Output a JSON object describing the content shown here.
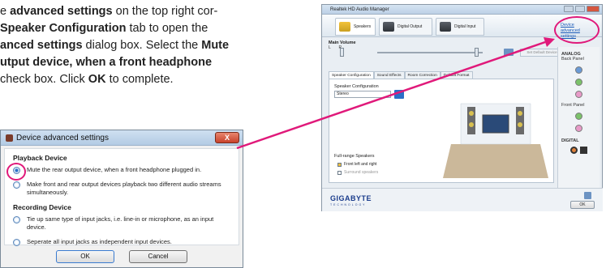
{
  "instructions": {
    "l1_pre": "e ",
    "l1_bold": "advanced settings",
    "l1_post": " on the top right cor-",
    "l2_bold": "Speaker Configuration",
    "l2_post": " tab to open the",
    "l3_bold": "anced settings",
    "l3_mid": " dialog box. Select the ",
    "l3_bold2": "Mute",
    "l4_bold": "utput device, when a front headphone",
    "l5_pre": " check box. Click ",
    "l5_bold": "OK",
    "l5_post": " to complete."
  },
  "dialog": {
    "title": "Device advanced settings",
    "close": "X",
    "playback_heading": "Playback Device",
    "opt_mute": "Mute the rear output device, when a front headphone plugged in.",
    "opt_make": "Make front and rear output devices playback two different audio streams simultaneously.",
    "recording_heading": "Recording Device",
    "opt_tie": "Tie up same type of input jacks, i.e. line-in or microphone, as an input device.",
    "opt_separate": "Seperate all input jacks as independent input devices.",
    "ok": "OK",
    "cancel": "Cancel"
  },
  "manager": {
    "title": "Realtek HD Audio Manager",
    "tabs": [
      "Speakers",
      "Digital Output",
      "Digital Input"
    ],
    "advanced_link": "Device advanced settings",
    "main_volume": "Main Volume",
    "balance_left": "L",
    "balance_right": "R",
    "set_default": "Set Default Device",
    "subtabs": [
      "Speaker Configuration",
      "Sound Effects",
      "Room Correction",
      "Default Format"
    ],
    "speaker_config_label": "Speaker Configuration",
    "speaker_config_value": "Stereo",
    "fullrange_label": "Full-range Speakers",
    "fullrange_front": "Front left and right",
    "fullrange_surround": "Surround speakers",
    "analog": "ANALOG",
    "back_panel": "Back Panel",
    "front_panel": "Front Panel",
    "digital": "DIGITAL",
    "brand": "GIGABYTE",
    "brand_sub": "TECHNOLOGY",
    "ok": "OK",
    "info": "i"
  },
  "colors": {
    "highlight": "#e0197a",
    "jack_blue": "#6a9ad6",
    "jack_green": "#7bc26a",
    "jack_pink": "#e89ac8",
    "jack_orange": "#e0813a"
  }
}
